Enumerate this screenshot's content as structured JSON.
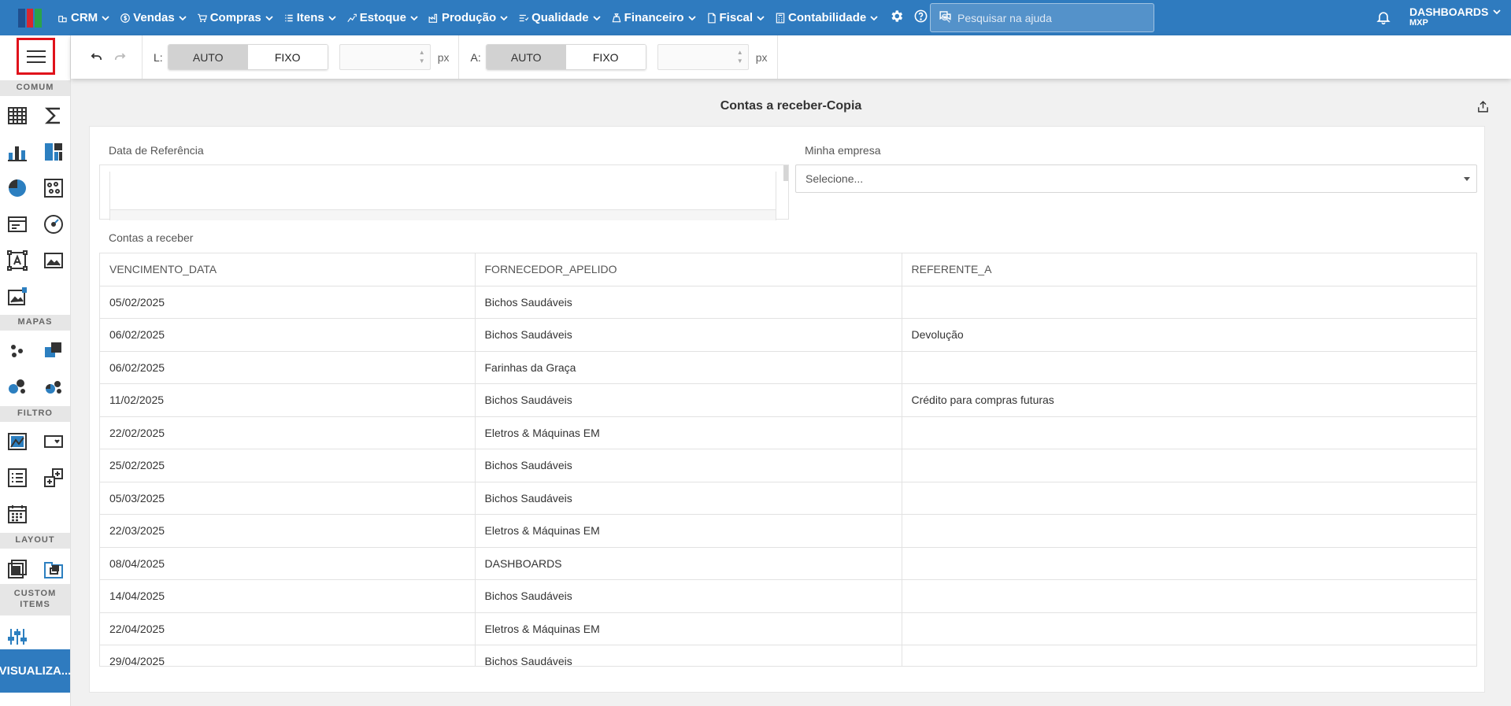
{
  "topbar": {
    "logo_colors": [
      "#1f4f8f",
      "#d9262f",
      "#2aa34a"
    ],
    "menu": [
      {
        "label": "CRM",
        "icon": "crm-icon"
      },
      {
        "label": "Vendas",
        "icon": "dollar-circle-icon"
      },
      {
        "label": "Compras",
        "icon": "cart-icon"
      },
      {
        "label": "Itens",
        "icon": "items-icon"
      },
      {
        "label": "Estoque",
        "icon": "stock-icon"
      },
      {
        "label": "Produção",
        "icon": "factory-icon"
      },
      {
        "label": "Qualidade",
        "icon": "quality-icon"
      },
      {
        "label": "Financeiro",
        "icon": "money-bag-icon"
      },
      {
        "label": "Fiscal",
        "icon": "document-icon"
      },
      {
        "label": "Contabilidade",
        "icon": "calculator-icon"
      }
    ],
    "search_placeholder": "Pesquisar na ajuda",
    "account_name": "DASHBOARDS",
    "account_sub": "MXP"
  },
  "sidebar": {
    "sections": {
      "comum": "COMUM",
      "mapas": "MAPAS",
      "filtro": "FILTRO",
      "layout": "LAYOUT",
      "custom_items": "CUSTOM ITEMS"
    },
    "visualize_label": "VISUALIZA..."
  },
  "toolbar": {
    "width_label": "L:",
    "height_label": "A:",
    "auto_label": "AUTO",
    "fixed_label": "FIXO",
    "unit": "px"
  },
  "dashboard": {
    "title": "Contas a receber-Copia",
    "date_filter_label": "Data de Referência",
    "company_filter_label": "Minha empresa",
    "company_placeholder": "Selecione...",
    "grid_title": "Contas a receber",
    "columns": [
      "VENCIMENTO_DATA",
      "FORNECEDOR_APELIDO",
      "REFERENTE_A"
    ],
    "rows": [
      [
        "05/02/2025",
        "Bichos Saudáveis",
        ""
      ],
      [
        "06/02/2025",
        "Bichos Saudáveis",
        "Devolução"
      ],
      [
        "06/02/2025",
        "Farinhas da Graça",
        ""
      ],
      [
        "11/02/2025",
        "Bichos Saudáveis",
        "Crédito para compras futuras"
      ],
      [
        "22/02/2025",
        "Eletros & Máquinas EM",
        ""
      ],
      [
        "25/02/2025",
        "Bichos Saudáveis",
        ""
      ],
      [
        "05/03/2025",
        "Bichos Saudáveis",
        ""
      ],
      [
        "22/03/2025",
        "Eletros & Máquinas EM",
        ""
      ],
      [
        "08/04/2025",
        "DASHBOARDS",
        ""
      ],
      [
        "14/04/2025",
        "Bichos Saudáveis",
        ""
      ],
      [
        "22/04/2025",
        "Eletros & Máquinas EM",
        ""
      ],
      [
        "29/04/2025",
        "Bichos Saudáveis",
        ""
      ]
    ]
  }
}
